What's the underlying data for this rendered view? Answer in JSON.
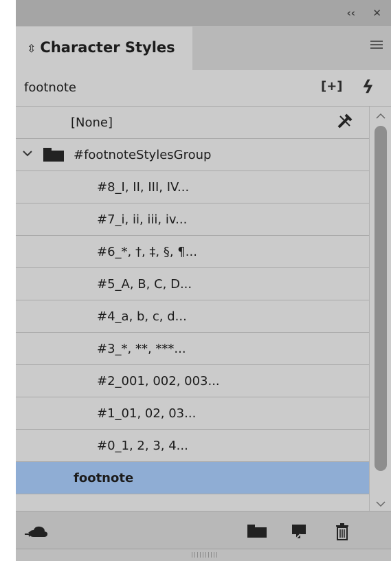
{
  "titlebar": {
    "collapse_icon": "double-chevron-left-icon",
    "close_icon": "close-icon"
  },
  "tab": {
    "label": "Character Styles",
    "arrows_icon": "up-down-arrows-icon"
  },
  "panel_menu_icon": "hamburger-menu-icon",
  "namebar": {
    "style_name": "footnote",
    "new_group_icon": "new-style-group-icon",
    "quick_apply_icon": "lightning-icon"
  },
  "list": {
    "none_row": {
      "label": "[None]",
      "icon": "clear-override-icon"
    },
    "group": {
      "label": "#footnoteStylesGroup",
      "expanded": true
    },
    "items": [
      {
        "label": "#8_I, II, III, IV..."
      },
      {
        "label": "#7_i, ii, iii, iv..."
      },
      {
        "label": "#6_*, †, ‡, §, ¶..."
      },
      {
        "label": "#5_A, B, C, D..."
      },
      {
        "label": "#4_a, b, c, d..."
      },
      {
        "label": "#3_*, **, ***..."
      },
      {
        "label": "#2_001, 002, 003..."
      },
      {
        "label": "#1_01, 02, 03..."
      },
      {
        "label": "#0_1, 2, 3, 4..."
      }
    ],
    "selected_row": {
      "label": "footnote"
    }
  },
  "footer": {
    "icons": [
      "cc-library-icon",
      "new-group-folder-icon",
      "new-style-icon",
      "delete-trash-icon"
    ]
  },
  "colors": {
    "selected": "#8fadd4",
    "panel_bg": "#cbcbcb",
    "frame": "#b8b8b8"
  }
}
